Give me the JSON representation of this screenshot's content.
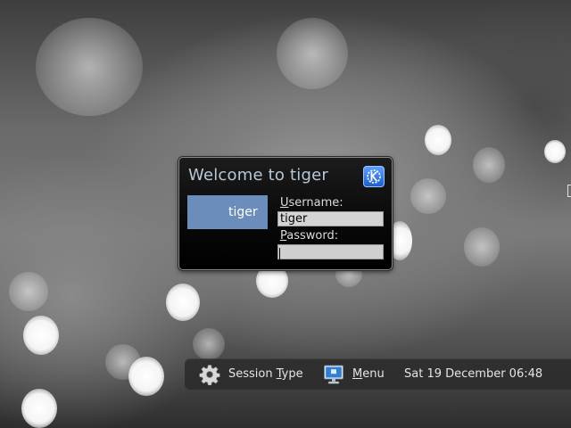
{
  "dialog": {
    "title": "Welcome to tiger",
    "logo_icon": "kde-logo-icon",
    "user_tile_label": "tiger",
    "username_label_mnemonic": "U",
    "username_label_rest": "sername:",
    "username_value": "tiger",
    "password_label_mnemonic": "P",
    "password_label_rest": "assword:",
    "password_value": ""
  },
  "bottom_bar": {
    "session_icon": "gear-icon",
    "session_label_prefix": "Session ",
    "session_label_mnemonic": "T",
    "session_label_suffix": "ype",
    "menu_icon": "computer-icon",
    "menu_label_mnemonic": "M",
    "menu_label_rest": "enu",
    "datetime": "Sat 19 December 06:48"
  },
  "colors": {
    "title_text": "#b8c8d6",
    "user_tile": "#6a8dbc",
    "input_bg": "#d4d4d4",
    "bar_bg": "#282828"
  }
}
